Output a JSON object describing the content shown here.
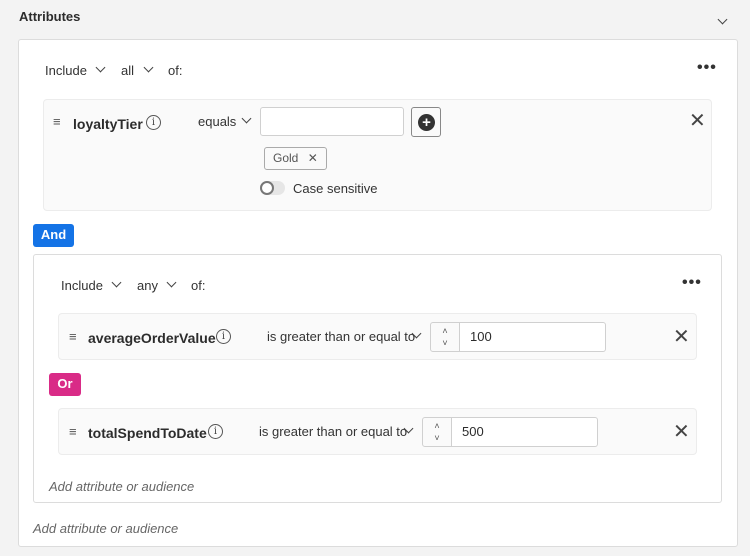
{
  "section": {
    "title": "Attributes"
  },
  "group1": {
    "include": "Include",
    "match": "all",
    "of": "of:",
    "rule": {
      "attribute": "loyaltyTier",
      "operator": "equals",
      "input_value": "",
      "tags": [
        "Gold"
      ],
      "case_sensitive_label": "Case sensitive",
      "case_sensitive": false
    }
  },
  "and_label": "And",
  "group2": {
    "include": "Include",
    "match": "any",
    "of": "of:",
    "rules": [
      {
        "attribute": "averageOrderValue",
        "operator": "is greater than or equal to",
        "value": "100"
      },
      {
        "attribute": "totalSpendToDate",
        "operator": "is greater than or equal to",
        "value": "500"
      }
    ],
    "or_label": "Or",
    "add_label": "Add attribute or audience"
  },
  "add_label": "Add attribute or audience",
  "colors": {
    "and": "#1473e6",
    "or": "#d92b87"
  }
}
